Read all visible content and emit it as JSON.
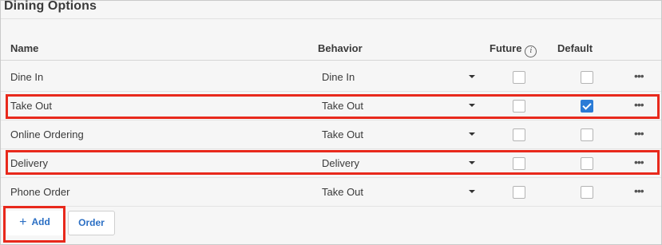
{
  "section": {
    "title": "Dining Options"
  },
  "columns": {
    "name": "Name",
    "behavior": "Behavior",
    "future": "Future",
    "default": "Default"
  },
  "rows": [
    {
      "name": "Dine In",
      "behavior": "Dine In",
      "future": false,
      "default": false,
      "highlighted": false
    },
    {
      "name": "Take Out",
      "behavior": "Take Out",
      "future": false,
      "default": true,
      "highlighted": true
    },
    {
      "name": "Online Ordering",
      "behavior": "Take Out",
      "future": false,
      "default": false,
      "highlighted": false
    },
    {
      "name": "Delivery",
      "behavior": "Delivery",
      "future": false,
      "default": false,
      "highlighted": true
    },
    {
      "name": "Phone Order",
      "behavior": "Take Out",
      "future": false,
      "default": false,
      "highlighted": false
    }
  ],
  "actions": {
    "add_label": "Add",
    "order_label": "Order"
  },
  "icons": {
    "info": "info-icon",
    "more": "more-horizontal-icon",
    "add": "plus-icon",
    "caret": "caret-down-icon"
  },
  "colors": {
    "accent": "#2b7bd6",
    "highlight": "#e8291c"
  }
}
